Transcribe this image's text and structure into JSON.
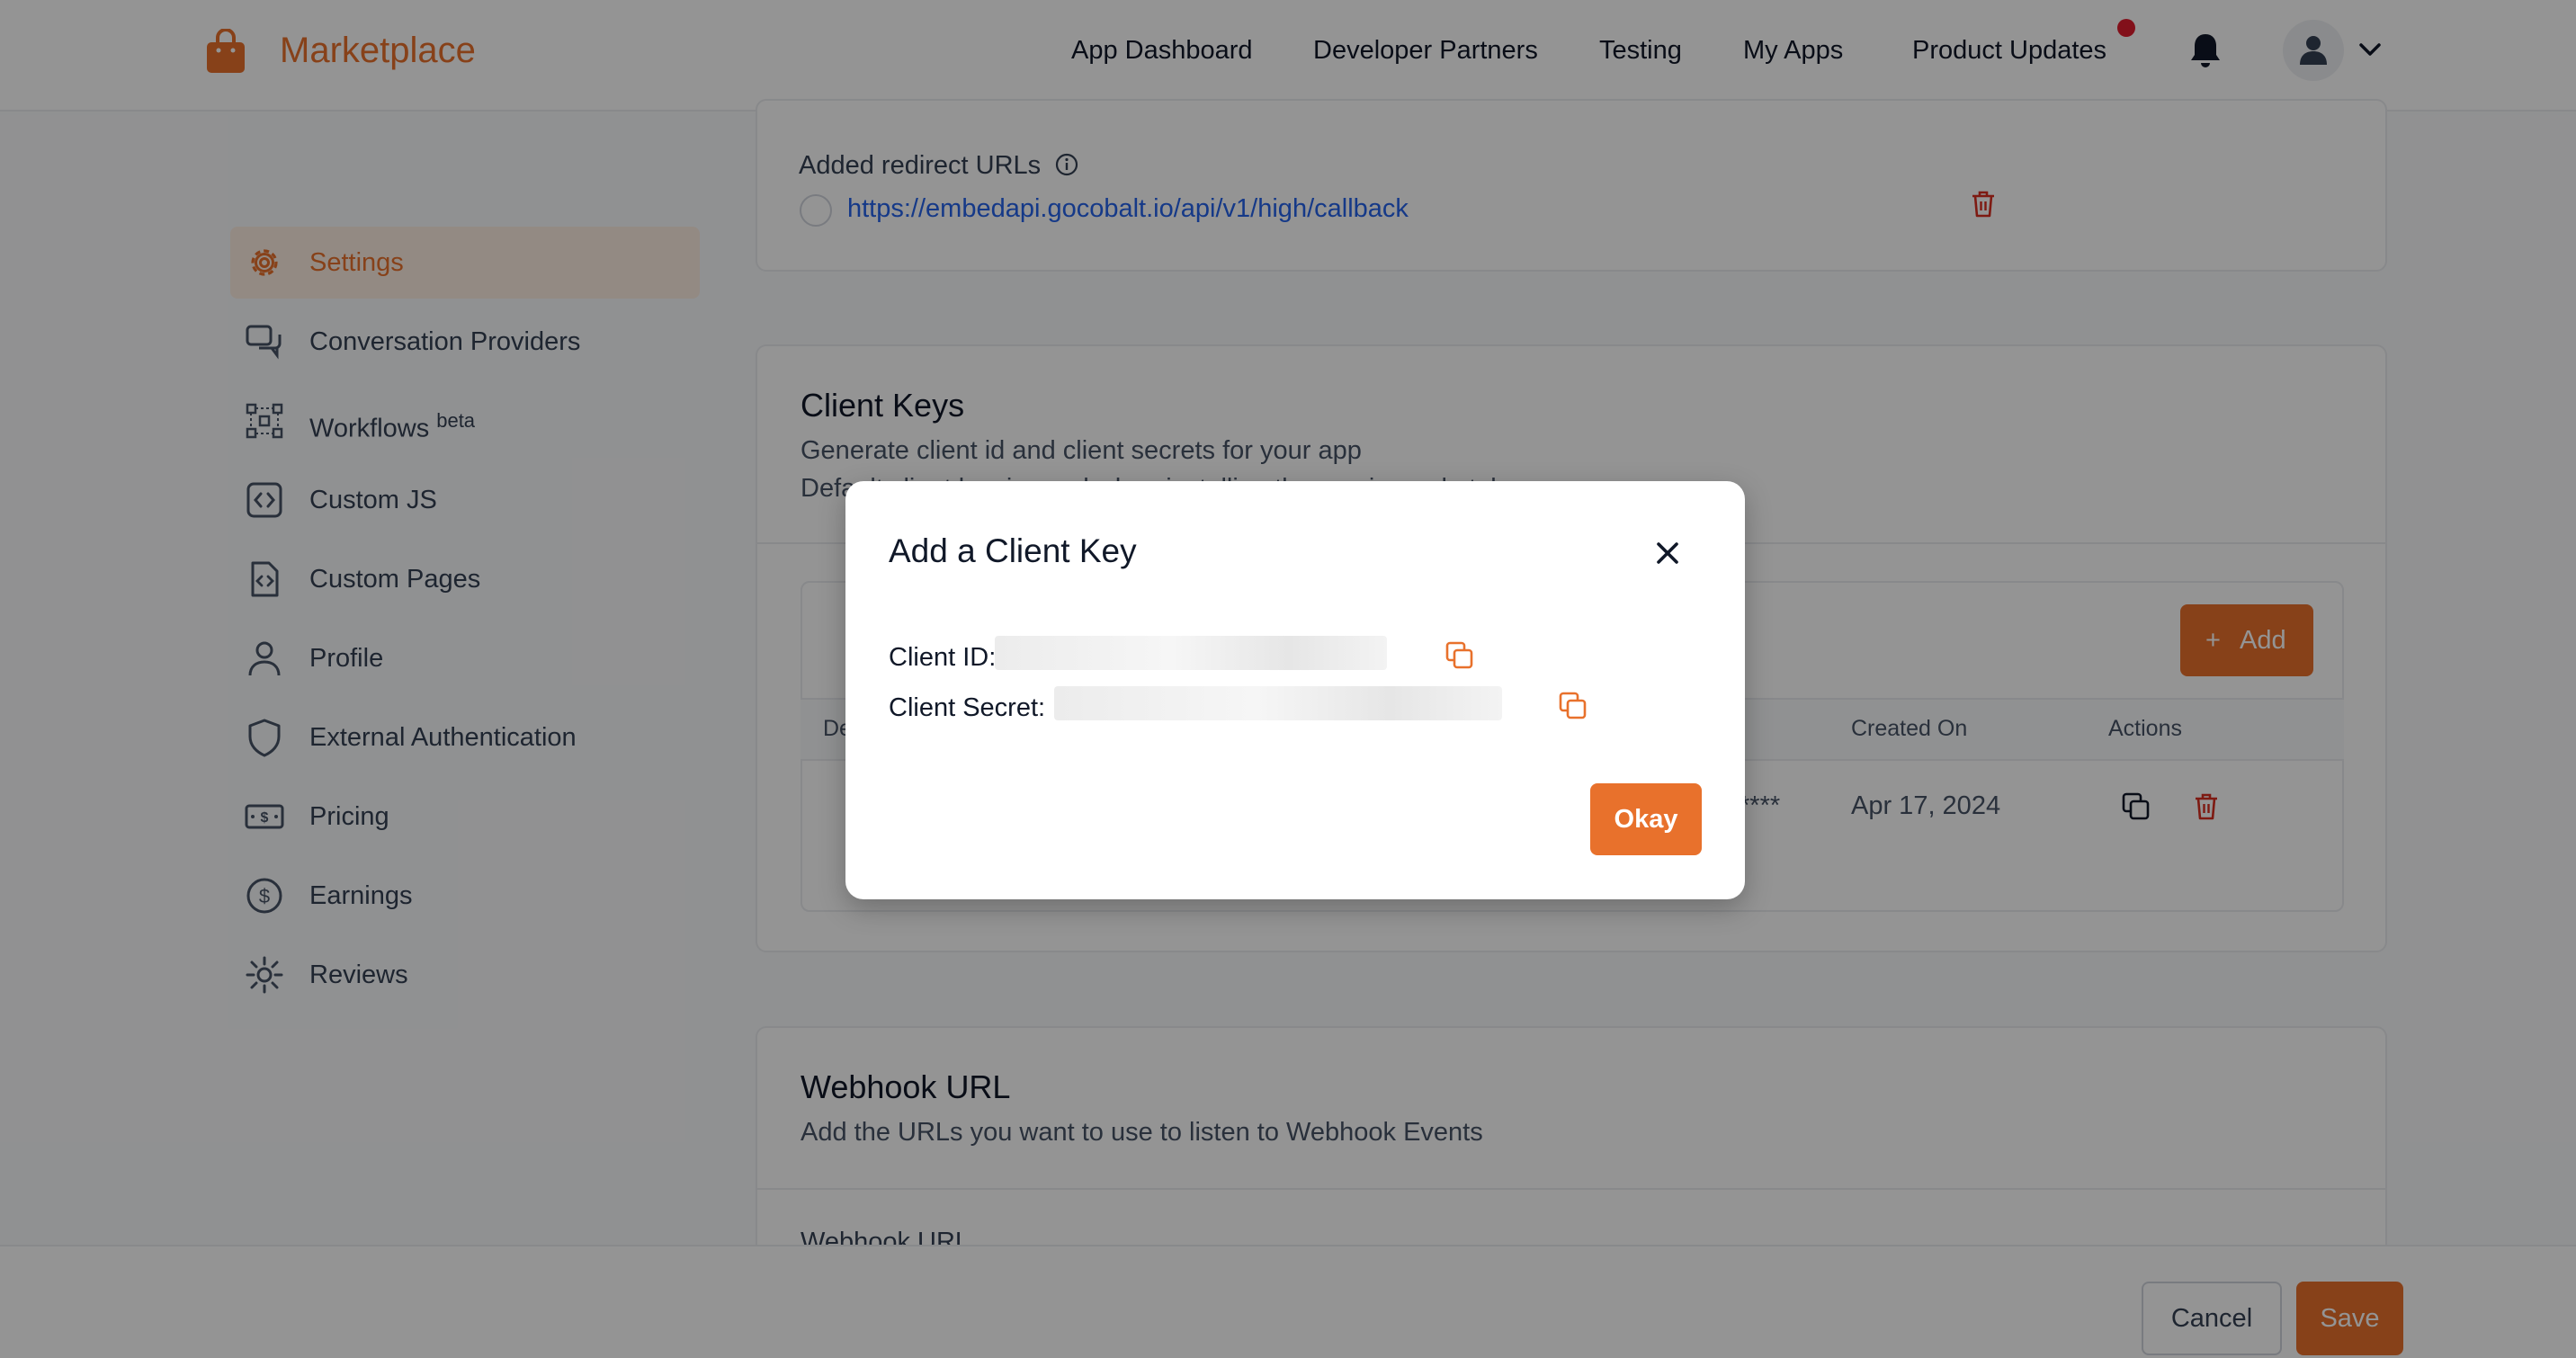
{
  "topnav": {
    "brand": "Marketplace",
    "links": [
      "App Dashboard",
      "Developer Partners",
      "Testing",
      "My Apps",
      "Product Updates"
    ]
  },
  "sidebar": {
    "items": [
      {
        "label": "Settings",
        "icon": "gear-icon",
        "active": true
      },
      {
        "label": "Conversation Providers",
        "icon": "chat-bubbles-icon"
      },
      {
        "label": "Workflows",
        "badge": "beta",
        "icon": "workflow-icon"
      },
      {
        "label": "Custom JS",
        "icon": "code-icon"
      },
      {
        "label": "Custom Pages",
        "icon": "custom-page-icon"
      },
      {
        "label": "Profile",
        "icon": "user-icon"
      },
      {
        "label": "External Authentication",
        "icon": "shield-icon"
      },
      {
        "label": "Pricing",
        "icon": "price-tag-icon"
      },
      {
        "label": "Earnings",
        "icon": "dollar-circle-icon"
      },
      {
        "label": "Reviews",
        "icon": "star-burst-icon"
      }
    ]
  },
  "redirect": {
    "label": "Added redirect URLs",
    "url": "https://embedapi.gocobalt.io/api/v1/high/callback"
  },
  "client_keys": {
    "title": "Client Keys",
    "subtitle": "Generate client id and client secrets for your app",
    "subtitle2": "Default client key is used when installing the app in marketplace",
    "add_label": "Add",
    "columns": {
      "first": "Description",
      "created_on": "Created On",
      "actions": "Actions"
    },
    "row": {
      "masked": "****",
      "created_on": "Apr 17, 2024"
    }
  },
  "webhook": {
    "title": "Webhook URL",
    "subtitle": "Add the URLs you want to use to listen to Webhook Events",
    "field_label": "Webhook URL"
  },
  "footer": {
    "cancel": "Cancel",
    "save": "Save"
  },
  "modal": {
    "title": "Add a Client Key",
    "client_id_label": "Client ID:",
    "client_secret_label": "Client Secret:",
    "okay": "Okay"
  },
  "colors": {
    "accent": "#e8712c",
    "link": "#2563eb",
    "danger": "#d92d20"
  }
}
